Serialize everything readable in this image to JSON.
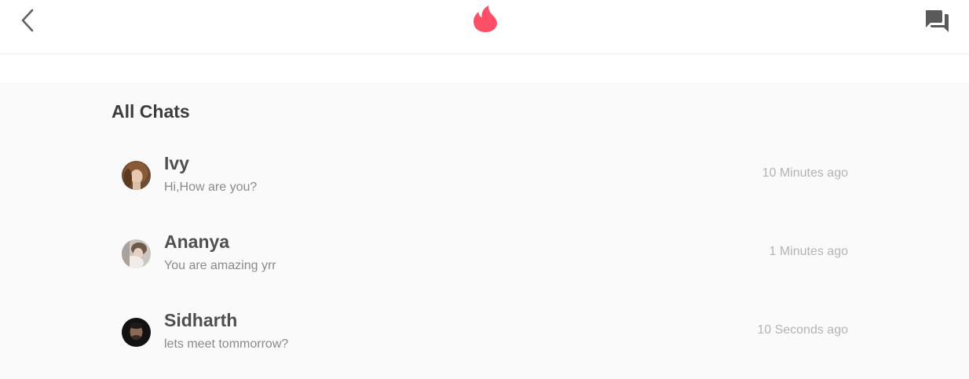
{
  "header": {
    "back_icon": "chevron-left-icon",
    "logo_icon": "flame-icon",
    "chat_icon": "chat-bubbles-icon",
    "accent_color": "#fd5068"
  },
  "main": {
    "title": "All Chats",
    "chats": [
      {
        "name": "Ivy",
        "message": "Hi,How are you?",
        "time": "10 Minutes ago",
        "avatar_icon": "avatar-ivy"
      },
      {
        "name": "Ananya",
        "message": "You are amazing yrr",
        "time": "1 Minutes ago",
        "avatar_icon": "avatar-ananya"
      },
      {
        "name": "Sidharth",
        "message": "lets meet tommorrow?",
        "time": "10 Seconds ago",
        "avatar_icon": "avatar-sidharth"
      }
    ]
  }
}
